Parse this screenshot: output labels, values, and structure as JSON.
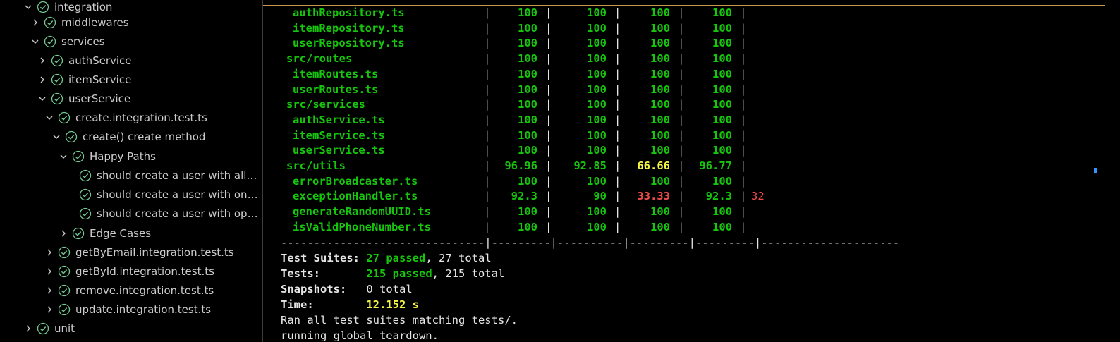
{
  "tree": {
    "nodes": [
      {
        "label": "integration",
        "depth": 0,
        "expanded": true
      },
      {
        "label": "middlewares",
        "depth": 1,
        "expanded": false
      },
      {
        "label": "services",
        "depth": 1,
        "expanded": true
      },
      {
        "label": "authService",
        "depth": 2,
        "expanded": false
      },
      {
        "label": "itemService",
        "depth": 2,
        "expanded": false
      },
      {
        "label": "userService",
        "depth": 2,
        "expanded": true
      },
      {
        "label": "create.integration.test.ts",
        "depth": 3,
        "expanded": true
      },
      {
        "label": "create() create method",
        "depth": 4,
        "expanded": true
      },
      {
        "label": "Happy Paths",
        "depth": 5,
        "expanded": true
      },
      {
        "label": "should create a user with all fie...",
        "depth": 6,
        "expanded": null
      },
      {
        "label": "should create a user with only r...",
        "depth": 6,
        "expanded": null
      },
      {
        "label": "should create a user with optio...",
        "depth": 6,
        "expanded": null
      },
      {
        "label": "Edge Cases",
        "depth": 5,
        "expanded": false
      },
      {
        "label": "getByEmail.integration.test.ts",
        "depth": 3,
        "expanded": false
      },
      {
        "label": "getById.integration.test.ts",
        "depth": 3,
        "expanded": false
      },
      {
        "label": "remove.integration.test.ts",
        "depth": 3,
        "expanded": false
      },
      {
        "label": "update.integration.test.ts",
        "depth": 3,
        "expanded": false
      },
      {
        "label": "unit",
        "depth": 0,
        "expanded": false
      }
    ]
  },
  "coverage": {
    "rows": [
      {
        "file": "authRepository.ts",
        "indent": 2,
        "stmts": "100",
        "branch": "100",
        "funcs": "100",
        "lines": "100",
        "uncovered": "",
        "colors": [
          "g",
          "g",
          "g",
          "g"
        ]
      },
      {
        "file": "itemRepository.ts",
        "indent": 2,
        "stmts": "100",
        "branch": "100",
        "funcs": "100",
        "lines": "100",
        "uncovered": "",
        "colors": [
          "g",
          "g",
          "g",
          "g"
        ]
      },
      {
        "file": "userRepository.ts",
        "indent": 2,
        "stmts": "100",
        "branch": "100",
        "funcs": "100",
        "lines": "100",
        "uncovered": "",
        "colors": [
          "g",
          "g",
          "g",
          "g"
        ]
      },
      {
        "file": "src/routes",
        "indent": 1,
        "stmts": "100",
        "branch": "100",
        "funcs": "100",
        "lines": "100",
        "uncovered": "",
        "colors": [
          "g",
          "g",
          "g",
          "g"
        ]
      },
      {
        "file": "itemRoutes.ts",
        "indent": 2,
        "stmts": "100",
        "branch": "100",
        "funcs": "100",
        "lines": "100",
        "uncovered": "",
        "colors": [
          "g",
          "g",
          "g",
          "g"
        ]
      },
      {
        "file": "userRoutes.ts",
        "indent": 2,
        "stmts": "100",
        "branch": "100",
        "funcs": "100",
        "lines": "100",
        "uncovered": "",
        "colors": [
          "g",
          "g",
          "g",
          "g"
        ]
      },
      {
        "file": "src/services",
        "indent": 1,
        "stmts": "100",
        "branch": "100",
        "funcs": "100",
        "lines": "100",
        "uncovered": "",
        "colors": [
          "g",
          "g",
          "g",
          "g"
        ]
      },
      {
        "file": "authService.ts",
        "indent": 2,
        "stmts": "100",
        "branch": "100",
        "funcs": "100",
        "lines": "100",
        "uncovered": "",
        "colors": [
          "g",
          "g",
          "g",
          "g"
        ]
      },
      {
        "file": "itemService.ts",
        "indent": 2,
        "stmts": "100",
        "branch": "100",
        "funcs": "100",
        "lines": "100",
        "uncovered": "",
        "colors": [
          "g",
          "g",
          "g",
          "g"
        ]
      },
      {
        "file": "userService.ts",
        "indent": 2,
        "stmts": "100",
        "branch": "100",
        "funcs": "100",
        "lines": "100",
        "uncovered": "",
        "colors": [
          "g",
          "g",
          "g",
          "g"
        ]
      },
      {
        "file": "src/utils",
        "indent": 1,
        "stmts": "96.96",
        "branch": "92.85",
        "funcs": "66.66",
        "lines": "96.77",
        "uncovered": "",
        "colors": [
          "g",
          "g",
          "y",
          "g"
        ]
      },
      {
        "file": "errorBroadcaster.ts",
        "indent": 2,
        "stmts": "100",
        "branch": "100",
        "funcs": "100",
        "lines": "100",
        "uncovered": "",
        "colors": [
          "g",
          "g",
          "g",
          "g"
        ]
      },
      {
        "file": "exceptionHandler.ts",
        "indent": 2,
        "stmts": "92.3",
        "branch": "90",
        "funcs": "33.33",
        "lines": "92.3",
        "uncovered": "32",
        "colors": [
          "g",
          "g",
          "r",
          "g"
        ]
      },
      {
        "file": "generateRandomUUID.ts",
        "indent": 2,
        "stmts": "100",
        "branch": "100",
        "funcs": "100",
        "lines": "100",
        "uncovered": "",
        "colors": [
          "g",
          "g",
          "g",
          "g"
        ]
      },
      {
        "file": "isValidPhoneNumber.ts",
        "indent": 2,
        "stmts": "100",
        "branch": "100",
        "funcs": "100",
        "lines": "100",
        "uncovered": "",
        "colors": [
          "g",
          "g",
          "g",
          "g"
        ]
      }
    ],
    "separator": "-------------------------------|---------|----------|---------|---------|---------------------"
  },
  "summary": {
    "suites_label": "Test Suites:",
    "suites_passed": "27 passed",
    "suites_total": ", 27 total",
    "tests_label": "Tests:",
    "tests_passed": "215 passed",
    "tests_total": ", 215 total",
    "snapshots_label": "Snapshots:",
    "snapshots_value": "0 total",
    "time_label": "Time:",
    "time_value": "12.152 s",
    "ran_line": "Ran all test suites matching tests/.",
    "teardown_line": "running global teardown."
  },
  "colors": {
    "green": "#16c60c",
    "yellow": "#f5f543",
    "red": "#f14c4c",
    "check": "#73c991",
    "accent_border": "#c8944e"
  },
  "icons": {
    "passed": "check-circle-icon",
    "expand": "chevron-right-icon",
    "collapse": "chevron-down-icon"
  }
}
